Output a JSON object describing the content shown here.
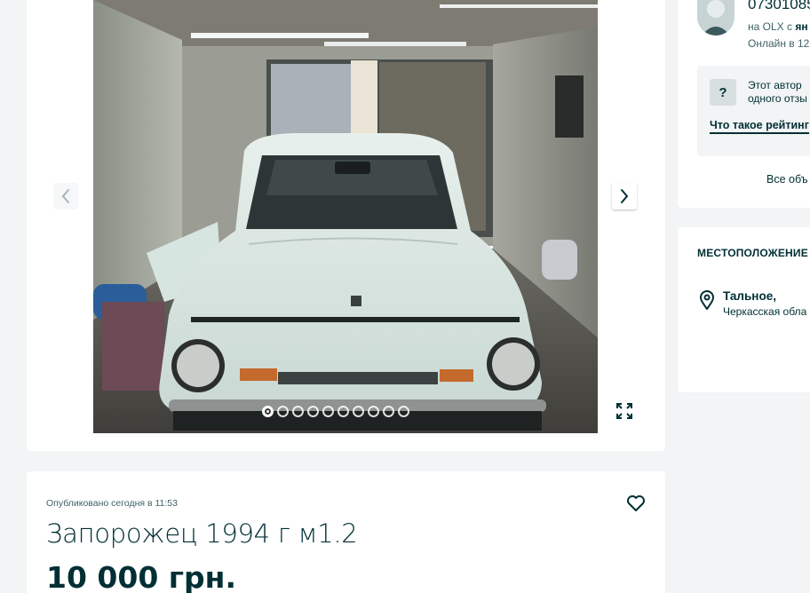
{
  "gallery": {
    "photo_count": 10,
    "active_index": 0
  },
  "ad": {
    "published": "Опубликовано сегодня в 11:53",
    "title": "Запорожец 1994 г м1.2",
    "price": "10 000 грн."
  },
  "seller": {
    "phone": "07301085",
    "since_prefix": "на OLX с ",
    "since_value": "ян",
    "online": "Онлайн в 12:",
    "rating_line1": "Этот автор",
    "rating_line2": "одного отзы",
    "rating_badge": "?",
    "rating_link": "Что такое рейтинг",
    "all_ads": "Все объ"
  },
  "location": {
    "heading": "МЕСТОПОЛОЖЕНИЕ",
    "city": "Тальное,",
    "region": "Черкасская обла"
  },
  "colors": {
    "primary": "#002f34",
    "muted": "#406367",
    "page_bg": "#f2f4f5",
    "card_bg": "#ffffff"
  },
  "icons": {
    "prev": "chevron-left-icon",
    "next": "chevron-right-icon",
    "fullscreen": "expand-icon",
    "favorite": "heart-icon",
    "location": "map-pin-icon",
    "rating": "question-icon"
  }
}
